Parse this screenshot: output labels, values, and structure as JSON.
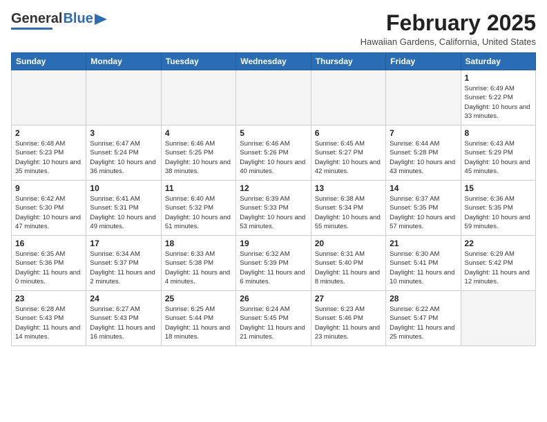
{
  "header": {
    "logo_general": "General",
    "logo_blue": "Blue",
    "month_title": "February 2025",
    "location": "Hawaiian Gardens, California, United States"
  },
  "calendar": {
    "weekdays": [
      "Sunday",
      "Monday",
      "Tuesday",
      "Wednesday",
      "Thursday",
      "Friday",
      "Saturday"
    ],
    "weeks": [
      [
        {
          "day": "",
          "info": ""
        },
        {
          "day": "",
          "info": ""
        },
        {
          "day": "",
          "info": ""
        },
        {
          "day": "",
          "info": ""
        },
        {
          "day": "",
          "info": ""
        },
        {
          "day": "",
          "info": ""
        },
        {
          "day": "1",
          "info": "Sunrise: 6:49 AM\nSunset: 5:22 PM\nDaylight: 10 hours and 33 minutes."
        }
      ],
      [
        {
          "day": "2",
          "info": "Sunrise: 6:48 AM\nSunset: 5:23 PM\nDaylight: 10 hours and 35 minutes."
        },
        {
          "day": "3",
          "info": "Sunrise: 6:47 AM\nSunset: 5:24 PM\nDaylight: 10 hours and 36 minutes."
        },
        {
          "day": "4",
          "info": "Sunrise: 6:46 AM\nSunset: 5:25 PM\nDaylight: 10 hours and 38 minutes."
        },
        {
          "day": "5",
          "info": "Sunrise: 6:46 AM\nSunset: 5:26 PM\nDaylight: 10 hours and 40 minutes."
        },
        {
          "day": "6",
          "info": "Sunrise: 6:45 AM\nSunset: 5:27 PM\nDaylight: 10 hours and 42 minutes."
        },
        {
          "day": "7",
          "info": "Sunrise: 6:44 AM\nSunset: 5:28 PM\nDaylight: 10 hours and 43 minutes."
        },
        {
          "day": "8",
          "info": "Sunrise: 6:43 AM\nSunset: 5:29 PM\nDaylight: 10 hours and 45 minutes."
        }
      ],
      [
        {
          "day": "9",
          "info": "Sunrise: 6:42 AM\nSunset: 5:30 PM\nDaylight: 10 hours and 47 minutes."
        },
        {
          "day": "10",
          "info": "Sunrise: 6:41 AM\nSunset: 5:31 PM\nDaylight: 10 hours and 49 minutes."
        },
        {
          "day": "11",
          "info": "Sunrise: 6:40 AM\nSunset: 5:32 PM\nDaylight: 10 hours and 51 minutes."
        },
        {
          "day": "12",
          "info": "Sunrise: 6:39 AM\nSunset: 5:33 PM\nDaylight: 10 hours and 53 minutes."
        },
        {
          "day": "13",
          "info": "Sunrise: 6:38 AM\nSunset: 5:34 PM\nDaylight: 10 hours and 55 minutes."
        },
        {
          "day": "14",
          "info": "Sunrise: 6:37 AM\nSunset: 5:35 PM\nDaylight: 10 hours and 57 minutes."
        },
        {
          "day": "15",
          "info": "Sunrise: 6:36 AM\nSunset: 5:35 PM\nDaylight: 10 hours and 59 minutes."
        }
      ],
      [
        {
          "day": "16",
          "info": "Sunrise: 6:35 AM\nSunset: 5:36 PM\nDaylight: 11 hours and 0 minutes."
        },
        {
          "day": "17",
          "info": "Sunrise: 6:34 AM\nSunset: 5:37 PM\nDaylight: 11 hours and 2 minutes."
        },
        {
          "day": "18",
          "info": "Sunrise: 6:33 AM\nSunset: 5:38 PM\nDaylight: 11 hours and 4 minutes."
        },
        {
          "day": "19",
          "info": "Sunrise: 6:32 AM\nSunset: 5:39 PM\nDaylight: 11 hours and 6 minutes."
        },
        {
          "day": "20",
          "info": "Sunrise: 6:31 AM\nSunset: 5:40 PM\nDaylight: 11 hours and 8 minutes."
        },
        {
          "day": "21",
          "info": "Sunrise: 6:30 AM\nSunset: 5:41 PM\nDaylight: 11 hours and 10 minutes."
        },
        {
          "day": "22",
          "info": "Sunrise: 6:29 AM\nSunset: 5:42 PM\nDaylight: 11 hours and 12 minutes."
        }
      ],
      [
        {
          "day": "23",
          "info": "Sunrise: 6:28 AM\nSunset: 5:43 PM\nDaylight: 11 hours and 14 minutes."
        },
        {
          "day": "24",
          "info": "Sunrise: 6:27 AM\nSunset: 5:43 PM\nDaylight: 11 hours and 16 minutes."
        },
        {
          "day": "25",
          "info": "Sunrise: 6:25 AM\nSunset: 5:44 PM\nDaylight: 11 hours and 18 minutes."
        },
        {
          "day": "26",
          "info": "Sunrise: 6:24 AM\nSunset: 5:45 PM\nDaylight: 11 hours and 21 minutes."
        },
        {
          "day": "27",
          "info": "Sunrise: 6:23 AM\nSunset: 5:46 PM\nDaylight: 11 hours and 23 minutes."
        },
        {
          "day": "28",
          "info": "Sunrise: 6:22 AM\nSunset: 5:47 PM\nDaylight: 11 hours and 25 minutes."
        },
        {
          "day": "",
          "info": ""
        }
      ]
    ]
  }
}
